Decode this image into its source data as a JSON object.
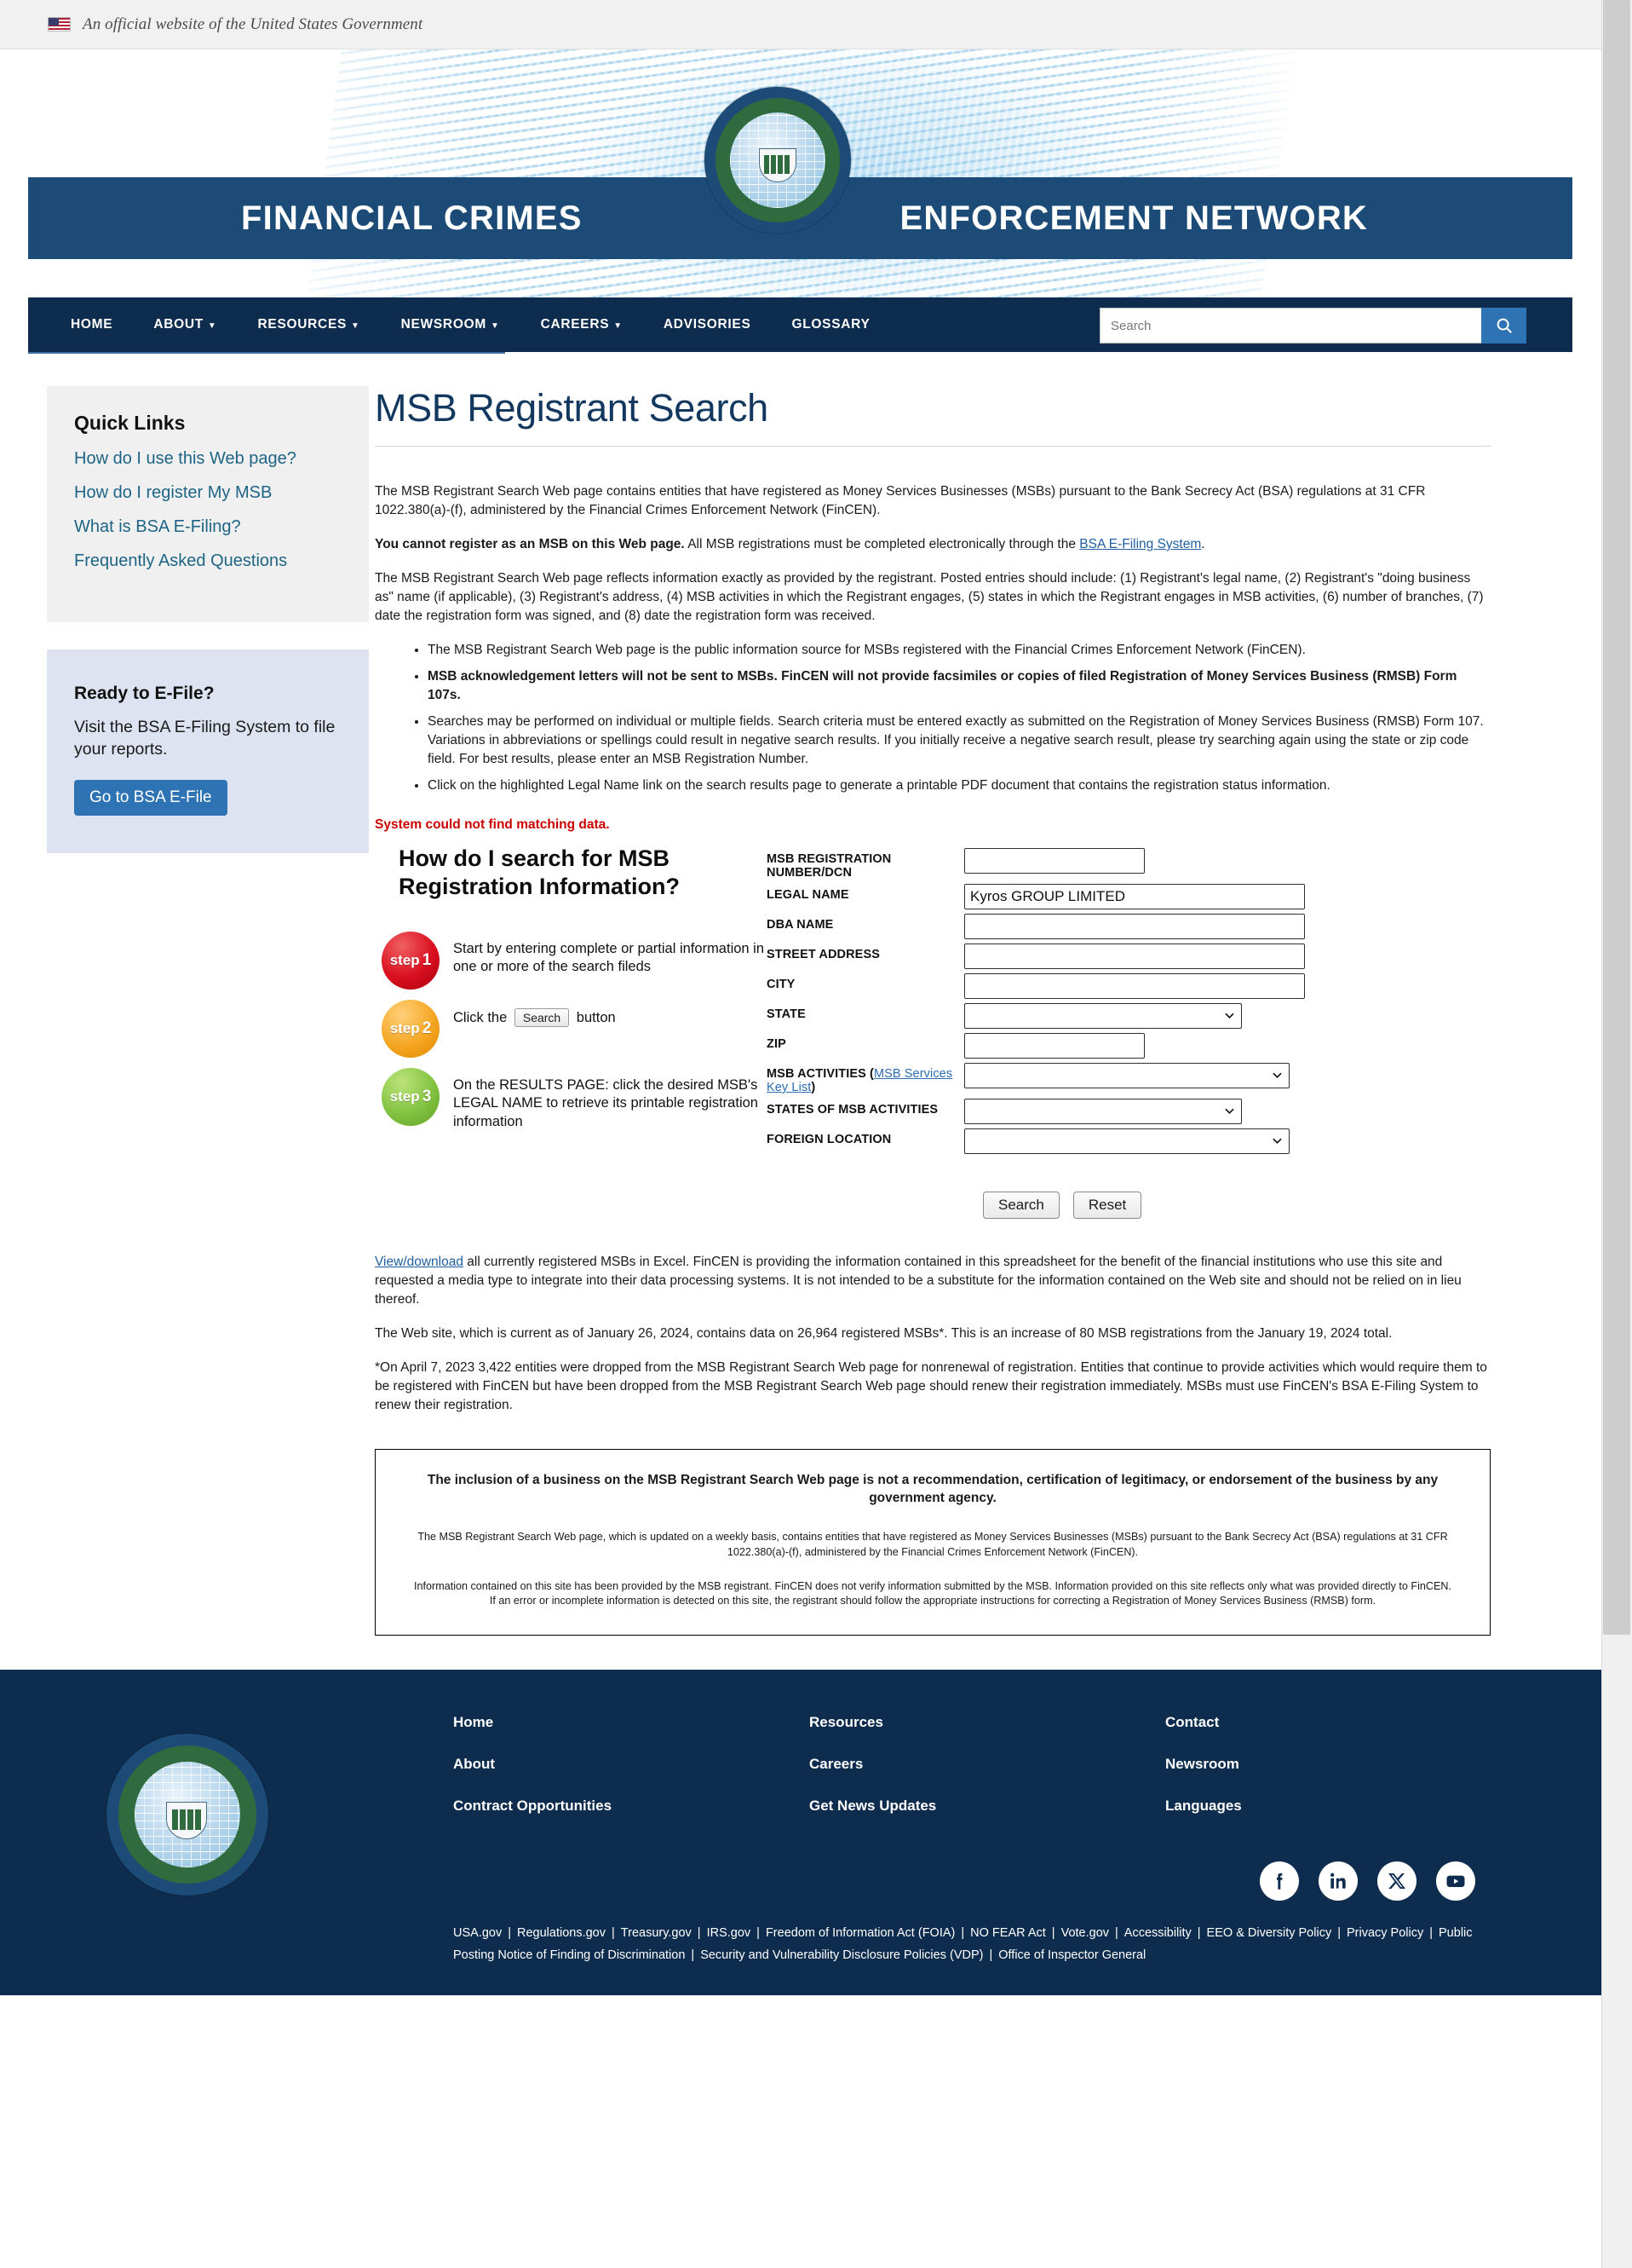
{
  "gov_banner": {
    "text": "An official website of the United States Government",
    "flag_icon": "us-flag-icon"
  },
  "masthead": {
    "title_left": "FINANCIAL CRIMES",
    "title_right": "ENFORCEMENT NETWORK",
    "seal_icon": "fincen-seal"
  },
  "nav": {
    "items": [
      {
        "label": "HOME",
        "has_caret": false
      },
      {
        "label": "ABOUT",
        "has_caret": true
      },
      {
        "label": "RESOURCES",
        "has_caret": true
      },
      {
        "label": "NEWSROOM",
        "has_caret": true
      },
      {
        "label": "CAREERS",
        "has_caret": true
      },
      {
        "label": "ADVISORIES",
        "has_caret": false
      },
      {
        "label": "GLOSSARY",
        "has_caret": false
      }
    ],
    "search_placeholder": "Search",
    "search_value": "",
    "search_icon": "search-icon"
  },
  "sidebar": {
    "quick_links_title": "Quick Links",
    "quick_links": [
      "How do I use this Web page?",
      "How do I register My MSB",
      "What is BSA E-Filing?",
      "Frequently Asked Questions"
    ],
    "efile_title": "Ready to E-File?",
    "efile_text": "Visit the BSA E-Filing System to file your reports.",
    "efile_button": "Go to BSA E-File"
  },
  "main": {
    "page_title": "MSB Registrant Search",
    "intro_p1": "The MSB Registrant Search Web page contains entities that have registered as Money Services Businesses (MSBs) pursuant to the Bank Secrecy Act (BSA) regulations at 31 CFR 1022.380(a)-(f), administered by the Financial Crimes Enforcement Network (FinCEN).",
    "intro_p2_bold": "You cannot register as an MSB on this Web page.",
    "intro_p2_rest": " All MSB registrations must be completed electronically through the ",
    "intro_p2_link": "BSA E-Filing System",
    "intro_p2_end": ".",
    "intro_p3": "The MSB Registrant Search Web page reflects information exactly as provided by the registrant. Posted entries should include: (1) Registrant's legal name, (2) Registrant's \"doing business as\" name (if applicable), (3) Registrant's address, (4) MSB activities in which the Registrant engages, (5) states in which the Registrant engages in MSB activities, (6) number of branches, (7) date the registration form was signed, and (8) date the registration form was received.",
    "bullets": [
      {
        "text": "The MSB Registrant Search Web page is the public information source for MSBs registered with the Financial Crimes Enforcement Network (FinCEN).",
        "bold": false
      },
      {
        "text": "MSB acknowledgement letters will not be sent to MSBs. FinCEN will not provide facsimiles or copies of filed Registration of Money Services Business (RMSB) Form 107s.",
        "bold": true
      },
      {
        "text": "Searches may be performed on individual or multiple fields. Search criteria must be entered exactly as submitted on the Registration of Money Services Business (RMSB) Form 107. Variations in abbreviations or spellings could result in negative search results. If you initially receive a negative search result, please try searching again using the state or zip code field. For best results, please enter an MSB Registration Number.",
        "bold": false
      },
      {
        "text": "Click on the highlighted Legal Name link on the search results page to generate a printable PDF document that contains the registration status information.",
        "bold": false
      }
    ],
    "error_message": "System could not find matching data.",
    "howto": {
      "heading": "How do I search for MSB Registration Information?",
      "steps": [
        {
          "badge": "step",
          "num": "1",
          "text": "Start by entering complete or partial information in one or more of the search fileds",
          "color": "#d90f1f"
        },
        {
          "badge": "step",
          "num": "2",
          "text_before": "Click the ",
          "button": "Search",
          "text_after": " button",
          "color": "#f5a623"
        },
        {
          "badge": "step",
          "num": "3",
          "text": "On the RESULTS PAGE: click the desired MSB's LEGAL NAME to retrieve its printable registration information",
          "color": "#82c341"
        }
      ]
    },
    "form": {
      "fields": [
        {
          "label": "MSB REGISTRATION NUMBER/DCN",
          "type": "text",
          "value": "",
          "width": "short"
        },
        {
          "label": "LEGAL NAME",
          "type": "text",
          "value": "Kyros GROUP LIMITED",
          "width": "long"
        },
        {
          "label": "DBA NAME",
          "type": "text",
          "value": "",
          "width": "long"
        },
        {
          "label": "STREET ADDRESS",
          "type": "text",
          "value": "",
          "width": "long"
        },
        {
          "label": "CITY",
          "type": "text",
          "value": "",
          "width": "long"
        },
        {
          "label": "STATE",
          "type": "select",
          "value": "",
          "width": "sel-md"
        },
        {
          "label": "ZIP",
          "type": "text",
          "value": "",
          "width": "short"
        },
        {
          "label": "MSB ACTIVITIES",
          "label_link": "MSB Services Key List",
          "type": "select",
          "value": "",
          "width": "sel-lg"
        },
        {
          "label": "STATES OF MSB ACTIVITIES",
          "type": "select",
          "value": "",
          "width": "sel-md"
        },
        {
          "label": "FOREIGN LOCATION",
          "type": "select",
          "value": "",
          "width": "sel-lg"
        }
      ],
      "search_button": "Search",
      "reset_button": "Reset"
    },
    "after_form": {
      "download_link": "View/download",
      "download_rest": " all currently registered MSBs in Excel. FinCEN is providing the information contained in this spreadsheet for the benefit of the financial institutions who use this site and requested a media type to integrate into their data processing systems. It is not intended to be a substitute for the information contained on the Web site and should not be relied on in lieu thereof.",
      "stats": "The Web site, which is current as of January 26, 2024, contains data on 26,964 registered MSBs*. This is an increase of 80 MSB registrations from the January 19, 2024 total.",
      "footnote": "*On April 7, 2023 3,422 entities were dropped from the MSB Registrant Search Web page for nonrenewal of registration. Entities that continue to provide activities which would require them to be registered with FinCEN but have been dropped from the MSB Registrant Search Web page should renew their registration immediately. MSBs must use FinCEN's BSA E-Filing System to renew their registration."
    },
    "disclaimer": {
      "heading": "The inclusion of a business on the MSB Registrant Search Web page is not a recommendation, certification of legitimacy, or endorsement of the business by any government agency.",
      "body1": "The MSB Registrant Search Web page, which is updated on a weekly basis, contains entities that have registered as Money Services Businesses (MSBs) pursuant to the Bank Secrecy Act (BSA) regulations at 31 CFR 1022.380(a)-(f), administered by the Financial Crimes Enforcement Network (FinCEN).",
      "body2": "Information contained on this site has been provided by the MSB registrant. FinCEN does not verify information submitted by the MSB. Information provided on this site reflects only what was provided directly to FinCEN. If an error or incomplete information is detected on this site, the registrant should follow the appropriate instructions for correcting a Registration of Money Services Business (RMSB) form."
    }
  },
  "footer": {
    "seal_icon": "fincen-seal",
    "col1": [
      "Home",
      "About",
      "Contract Opportunities"
    ],
    "col2": [
      "Resources",
      "Careers",
      "Get News Updates"
    ],
    "col3": [
      "Contact",
      "Newsroom",
      "Languages"
    ],
    "social": [
      {
        "name": "facebook-icon",
        "glyph": "f"
      },
      {
        "name": "linkedin-icon",
        "glyph": "in"
      },
      {
        "name": "x-twitter-icon",
        "glyph": "X"
      },
      {
        "name": "youtube-icon",
        "glyph": "▶"
      }
    ],
    "legal_links": [
      "USA.gov",
      "Regulations.gov",
      "Treasury.gov",
      "IRS.gov",
      "Freedom of Information Act (FOIA)",
      "NO FEAR Act",
      "Vote.gov",
      "Accessibility",
      "EEO & Diversity Policy",
      "Privacy Policy",
      "Public Posting Notice of Finding of Discrimination",
      "Security and Vulnerability Disclosure Policies (VDP)",
      "Office of Inspector General"
    ]
  },
  "colors": {
    "navy": "#0e2c4d",
    "banner_blue": "#1b4b76",
    "accent_blue": "#2e74b5",
    "error_red": "#cc0000",
    "link_blue": "#1f5fa0"
  }
}
